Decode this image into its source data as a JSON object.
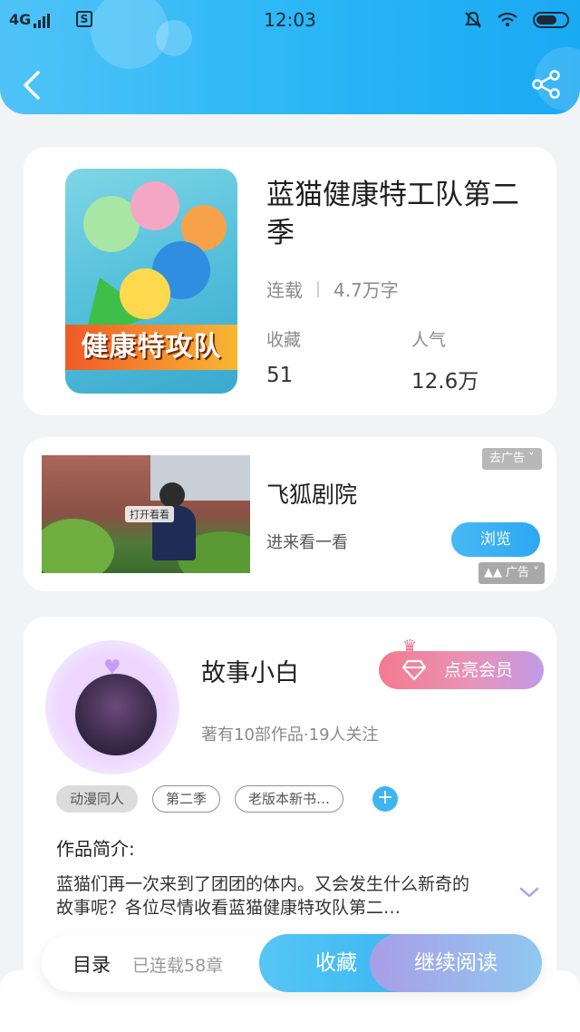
{
  "status_bar": {
    "network": "4G",
    "s_icon": "S",
    "time": "12:03",
    "icons": [
      "signal-icon",
      "sim-s-icon",
      "mute-icon",
      "wifi-icon",
      "battery-icon"
    ]
  },
  "header": {
    "back_icon": "chevron-left-icon",
    "share_icon": "share-icon"
  },
  "book": {
    "title": "蓝猫健康特工队第二季",
    "cover_banner": "健康特攻队",
    "status": "连载",
    "word_count": "4.7万字",
    "stats": [
      {
        "label": "收藏",
        "value": "51"
      },
      {
        "label": "人气",
        "value": "12.6万"
      }
    ]
  },
  "ad": {
    "title": "飞狐剧院",
    "subtitle": "进来看一看",
    "button": "浏览",
    "remove_label": "去广告",
    "ad_label": "广告",
    "image_tag": "打开看看"
  },
  "author": {
    "name": "故事小白",
    "vip_button": "点亮会员",
    "info": "著有10部作品·19人关注",
    "tags": [
      "动漫同人",
      "第二季",
      "老版本新书…"
    ],
    "intro_title": "作品简介:",
    "intro_text": "蓝猫们再一次来到了团团的体内。又会发生什么新奇的故事呢？各位尽情收看蓝猫健康特攻队第二…"
  },
  "bottom_bar": {
    "toc": "目录",
    "chapter_count": "已连载58章",
    "collect": "收藏",
    "continue_reading": "继续阅读"
  },
  "colors": {
    "header_gradient": [
      "#4fc3f7",
      "#1aa9f4"
    ],
    "accent_blue": "#3bb6f2",
    "vip_gradient": [
      "#f37a8f",
      "#c19ae7"
    ],
    "read_gradient": [
      "#a99ee8",
      "#8fc8f0"
    ]
  }
}
